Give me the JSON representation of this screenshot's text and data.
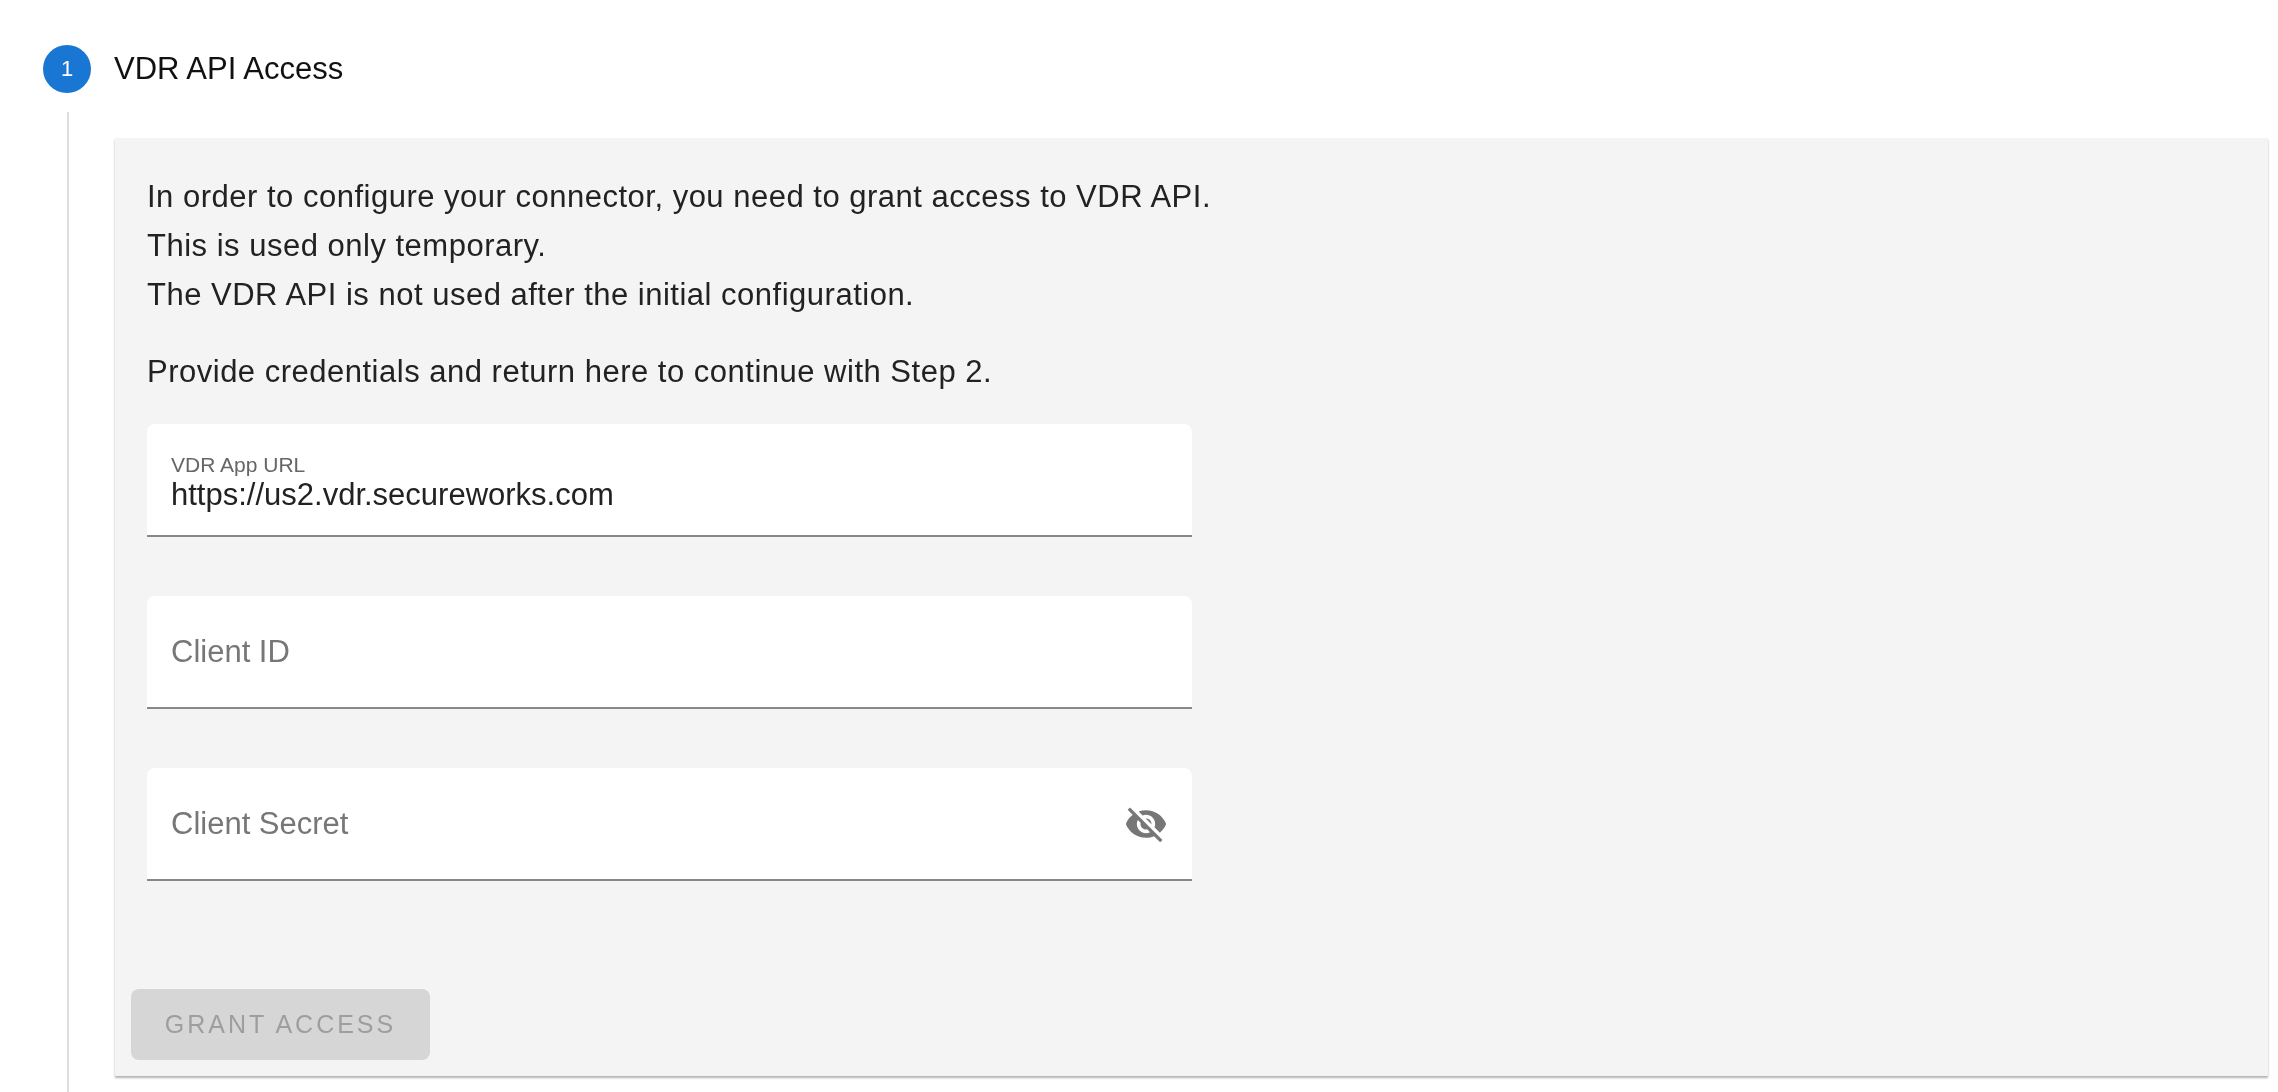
{
  "step": {
    "number": "1",
    "title": "VDR API Access",
    "active": true
  },
  "intro": [
    [
      "In order to configure your connector, you need to grant access to VDR API.",
      "This is used only temporary.",
      "The VDR API is not used after the initial configuration."
    ],
    [
      "Provide credentials and return here to continue with Step 2."
    ]
  ],
  "fields": [
    {
      "kind": "text",
      "label": "VDR App URL",
      "value": "https://us2.vdr.secureworks.com"
    },
    {
      "kind": "text",
      "placeholder": "Client ID"
    },
    {
      "kind": "password",
      "placeholder": "Client Secret"
    }
  ],
  "button": {
    "label": "GRANT ACCESS",
    "disabled": true
  }
}
